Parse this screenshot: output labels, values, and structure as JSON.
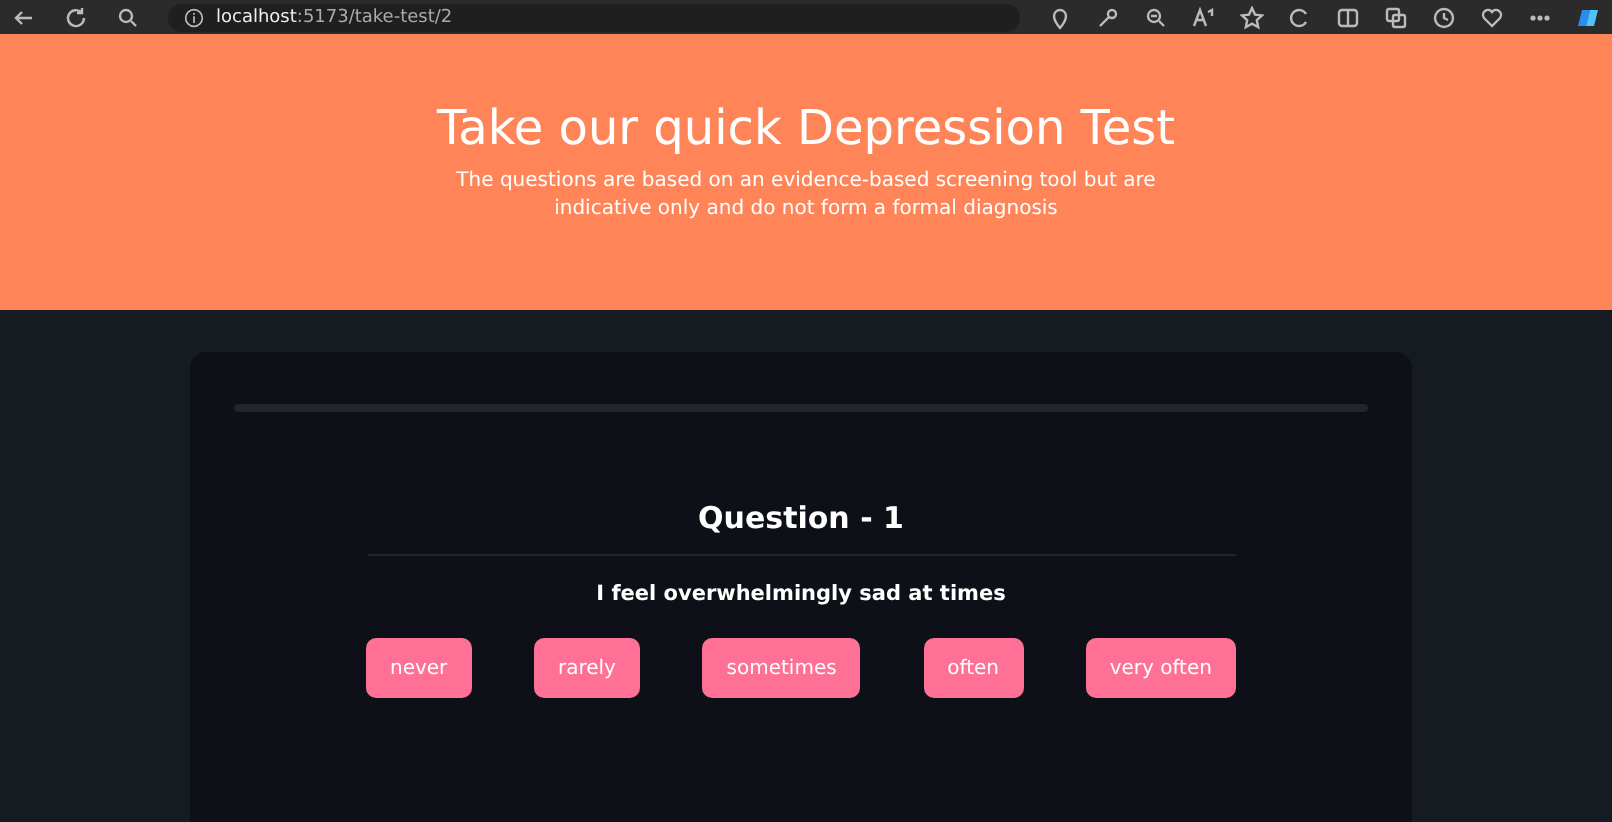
{
  "browser": {
    "url_host": "localhost",
    "url_path": ":5173/take-test/2"
  },
  "header": {
    "title": "Take our quick Depression Test",
    "subtitle": "The questions are based on an evidence-based screening tool but are indicative only and do not form a formal diagnosis"
  },
  "progress": {
    "level": 0
  },
  "question": {
    "title": "Question - 1",
    "text": "I feel overwhelmingly sad at times"
  },
  "answers": [
    {
      "label": "never"
    },
    {
      "label": "rarely"
    },
    {
      "label": "sometimes"
    },
    {
      "label": "often"
    },
    {
      "label": "very often"
    }
  ]
}
